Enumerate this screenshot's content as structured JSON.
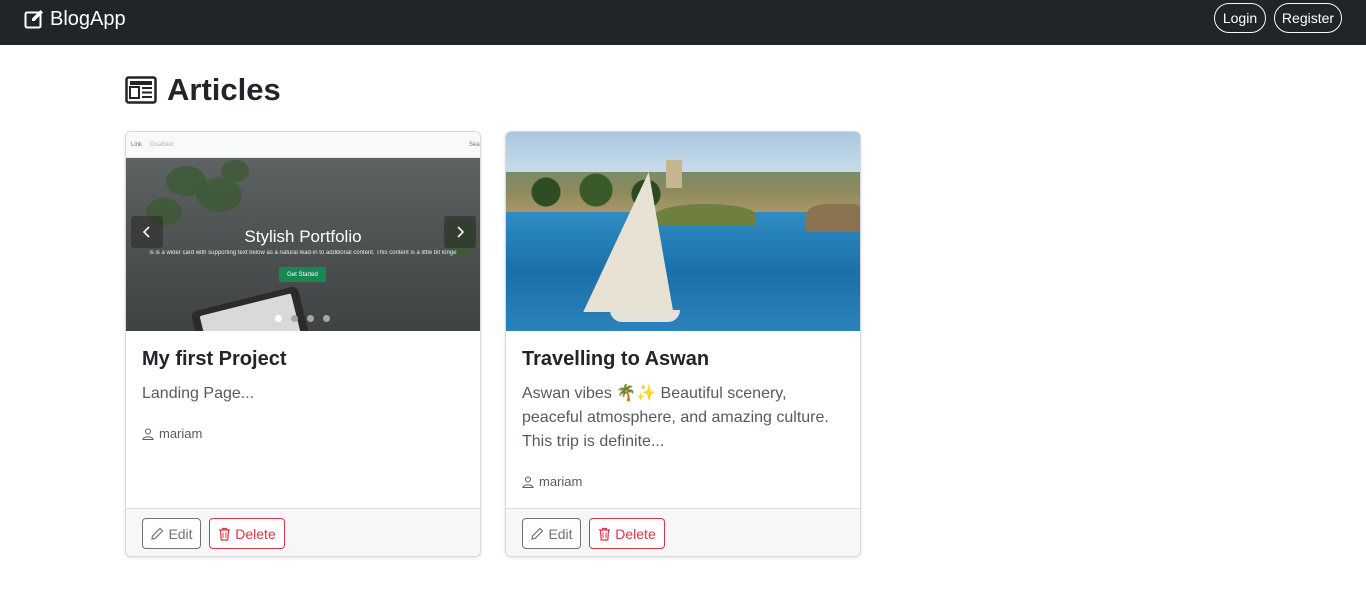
{
  "navbar": {
    "brand": "BlogApp",
    "brand_icon": "pencil-square-icon",
    "login_label": "Login",
    "register_label": "Register"
  },
  "page": {
    "title": "Articles",
    "title_icon": "newspaper-icon"
  },
  "articles": [
    {
      "title": "My first Project",
      "excerpt": "Landing Page...",
      "author": "mariam",
      "edit_label": "Edit",
      "delete_label": "Delete",
      "thumbnail": {
        "nav_link_1": "Link",
        "nav_link_2": "Disabled",
        "nav_right": "Sea",
        "hero_title": "Stylish Portfolio",
        "hero_subtitle": "is is a wider card with supporting text below as a natural lead-in to additional content. This content is a little bit longe",
        "cta_label": "Get Started"
      }
    },
    {
      "title": "Travelling to Aswan",
      "excerpt": "Aswan vibes 🌴✨ Beautiful scenery, peaceful atmosphere, and amazing culture. This trip is definite...",
      "author": "mariam",
      "edit_label": "Edit",
      "delete_label": "Delete"
    }
  ],
  "colors": {
    "navbar_bg": "#212529",
    "danger": "#dc3545",
    "secondary": "#6c757d"
  }
}
